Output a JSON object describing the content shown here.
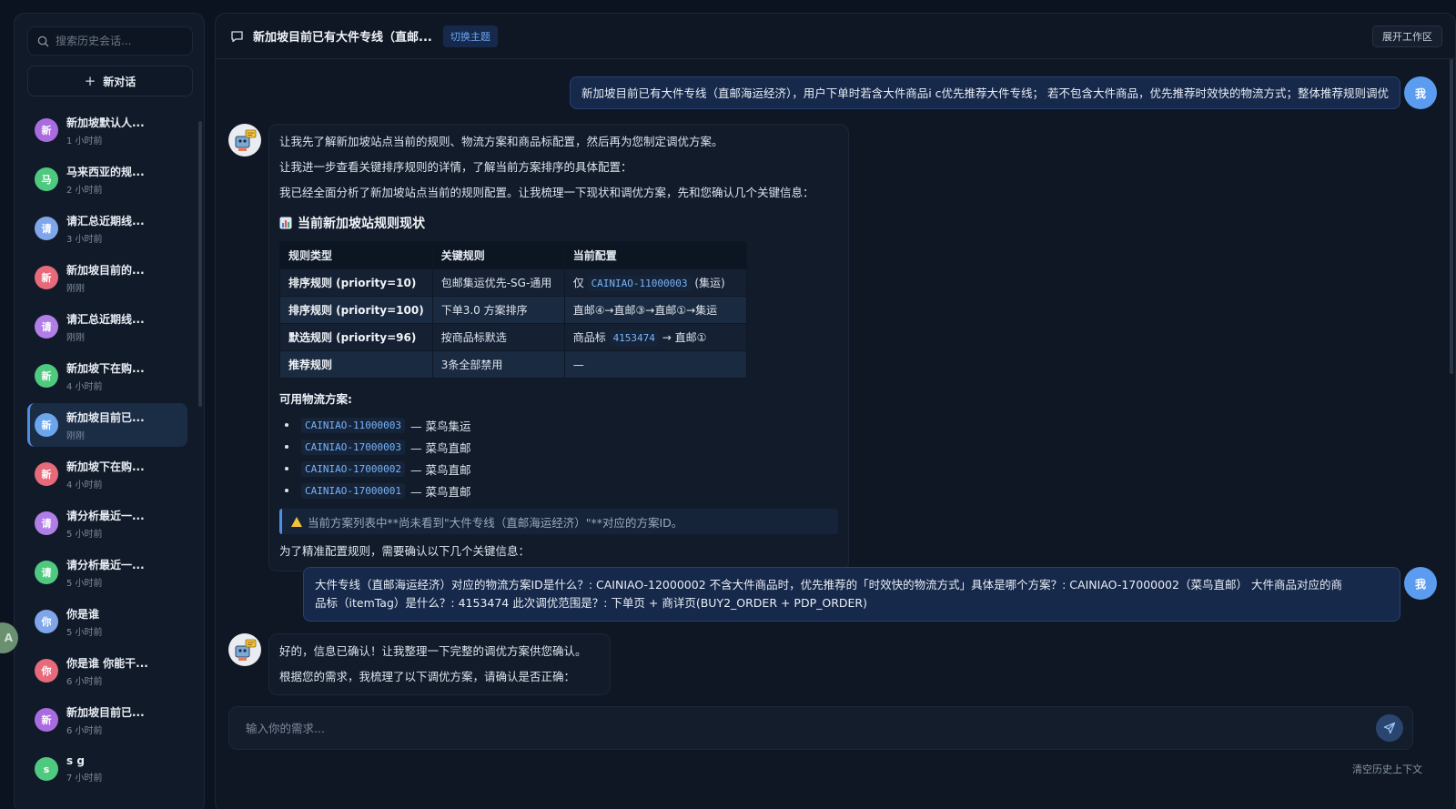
{
  "sidebar": {
    "search_placeholder": "搜索历史会话...",
    "new_chat_label": "新对话",
    "items": [
      {
        "initial": "新",
        "title": "新加坡默认人...",
        "time": "1 小时前",
        "color": "#a96be0"
      },
      {
        "initial": "马",
        "title": "马来西亚的规...",
        "time": "2 小时前",
        "color": "#4fc97f"
      },
      {
        "initial": "请",
        "title": "请汇总近期线...",
        "time": "3 小时前",
        "color": "#7fa6ea"
      },
      {
        "initial": "新",
        "title": "新加坡目前的...",
        "time": "刚刚",
        "color": "#e66a7a"
      },
      {
        "initial": "请",
        "title": "请汇总近期线...",
        "time": "刚刚",
        "color": "#b07ee6"
      },
      {
        "initial": "新",
        "title": "新加坡下在购...",
        "time": "4 小时前",
        "color": "#4fc97f"
      },
      {
        "initial": "新",
        "title": "新加坡目前已...",
        "time": "刚刚",
        "color": "#6aa5ee"
      },
      {
        "initial": "新",
        "title": "新加坡下在购...",
        "time": "4 小时前",
        "color": "#e66a7a"
      },
      {
        "initial": "请",
        "title": "请分析最近一...",
        "time": "5 小时前",
        "color": "#b07ee6"
      },
      {
        "initial": "请",
        "title": "请分析最近一...",
        "time": "5 小时前",
        "color": "#4fc97f"
      },
      {
        "initial": "你",
        "title": "你是谁",
        "time": "5 小时前",
        "color": "#7fa6ea"
      },
      {
        "initial": "你",
        "title": "你是谁 你能干...",
        "time": "6 小时前",
        "color": "#e66a7a"
      },
      {
        "initial": "新",
        "title": "新加坡目前已...",
        "time": "6 小时前",
        "color": "#a96be0"
      },
      {
        "initial": "s",
        "title": "s g",
        "time": "7 小时前",
        "color": "#4fc97f"
      }
    ],
    "active_index": 6,
    "edge_avatar_letter": "A"
  },
  "header": {
    "title": "新加坡目前已有大件专线（直邮...",
    "theme_button": "切换主题",
    "workspace_button": "展开工作区"
  },
  "messages": {
    "user1": {
      "avatar": "我",
      "text": "新加坡目前已有大件专线（直邮海运经济），用户下单时若含大件商品i c优先推荐大件专线； 若不包含大件商品，优先推荐时效快的物流方式；整体推荐规则调优"
    },
    "bot1": {
      "p1": "让我先了解新加坡站点当前的规则、物流方案和商品标配置，然后再为您制定调优方案。",
      "p2": "让我进一步查看关键排序规则的详情，了解当前方案排序的具体配置：",
      "p3": "我已经全面分析了新加坡站点当前的规则配置。让我梳理一下现状和调优方案，先和您确认几个关键信息：",
      "section_title": "当前新加坡站规则现状",
      "table": {
        "headers": [
          "规则类型",
          "关键规则",
          "当前配置"
        ],
        "rows": [
          {
            "type": "排序规则 (priority=10)",
            "rule": "包邮集运优先-SG-通用",
            "config_pre": "仅",
            "config_code": "CAINIAO-11000003",
            "config_post": "(集运)"
          },
          {
            "type": "排序规则 (priority=100)",
            "rule": "下单3.0 方案排序",
            "config_pre": "直邮④→直邮③→直邮①→集运",
            "config_code": "",
            "config_post": ""
          },
          {
            "type": "默选规则 (priority=96)",
            "rule": "按商品标默选",
            "config_pre": "商品标",
            "config_code": "4153474",
            "config_post": "→ 直邮①"
          },
          {
            "type": "推荐规则",
            "rule": "3条全部禁用",
            "config_pre": "—",
            "config_code": "",
            "config_post": ""
          }
        ]
      },
      "options_title": "可用物流方案:",
      "options": [
        {
          "code": "CAINIAO-11000003",
          "name": "— 菜鸟集运"
        },
        {
          "code": "CAINIAO-17000003",
          "name": "— 菜鸟直邮"
        },
        {
          "code": "CAINIAO-17000002",
          "name": "— 菜鸟直邮"
        },
        {
          "code": "CAINIAO-17000001",
          "name": "— 菜鸟直邮"
        }
      ],
      "warning": "当前方案列表中**尚未看到\"大件专线（直邮海运经济）\"**对应的方案ID。",
      "closing": "为了精准配置规则，需要确认以下几个关键信息："
    },
    "user2": {
      "avatar": "我",
      "line1": "大件专线（直邮海运经济）对应的物流方案ID是什么？: CAINIAO-12000002 不含大件商品时，优先推荐的「时效快的物流方式」具体是哪个方案？: CAINIAO-17000002（菜鸟直邮） 大件商品对应的商",
      "line2": "品标（itemTag）是什么？: 4153474 此次调优范围是？: 下单页 + 商详页(BUY2_ORDER + PDP_ORDER)"
    },
    "bot2": {
      "p1": "好的，信息已确认！让我整理一下完整的调优方案供您确认。",
      "p2": "根据您的需求，我梳理了以下调优方案，请确认是否正确："
    }
  },
  "composer": {
    "placeholder": "输入你的需求...",
    "clear_label": "清空历史上下文"
  },
  "colors": {
    "accent": "#4e8fe6",
    "background": "#0c1320",
    "panel": "#111a28",
    "user_bubble": "#16294a"
  }
}
